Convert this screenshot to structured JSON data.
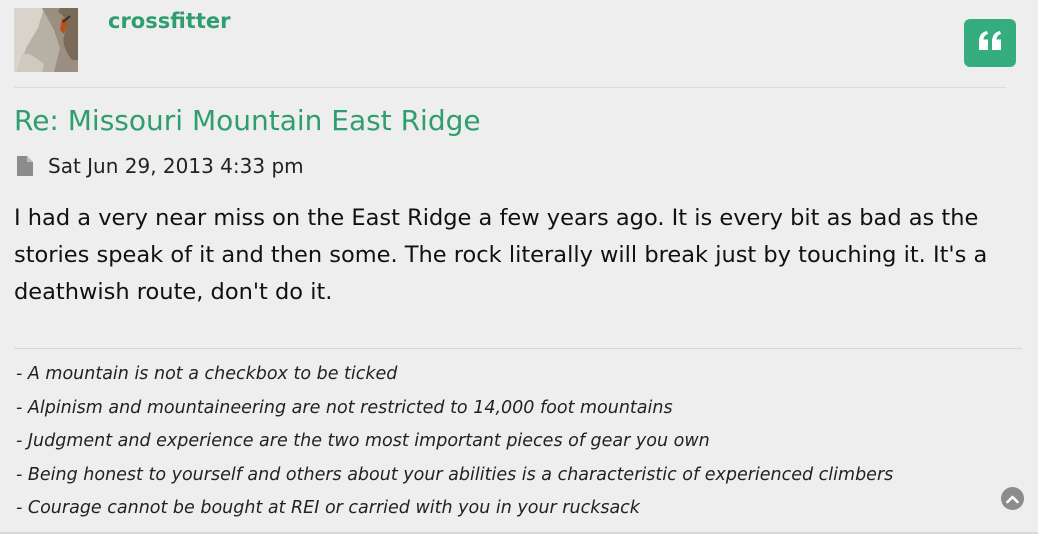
{
  "post": {
    "author": "crossfitter",
    "title": "Re: Missouri Mountain East Ridge",
    "date": "Sat Jun 29, 2013 4:33 pm",
    "body": "I had a very near miss on the East Ridge a few years ago. It is every bit as bad as the stories speak of it and then some. The rock literally will break just by touching it. It's a deathwish route, don't do it.",
    "signature": [
      "- A mountain is not a checkbox to be ticked",
      "- Alpinism and mountaineering are not restricted to 14,000 foot mountains",
      "- Judgment and experience are the two most important pieces of gear you own",
      "- Being honest to yourself and others about your abilities is a characteristic of experienced climbers",
      "- Courage cannot be bought at REI or carried with you in your rucksack"
    ]
  },
  "icons": {
    "quote": "quote-icon",
    "post_meta": "document-icon",
    "back_to_top": "chevron-up-circle-icon"
  },
  "colors": {
    "accent": "#2e9e6f",
    "quote_button": "#36ad7f",
    "background": "#eeeeee"
  }
}
